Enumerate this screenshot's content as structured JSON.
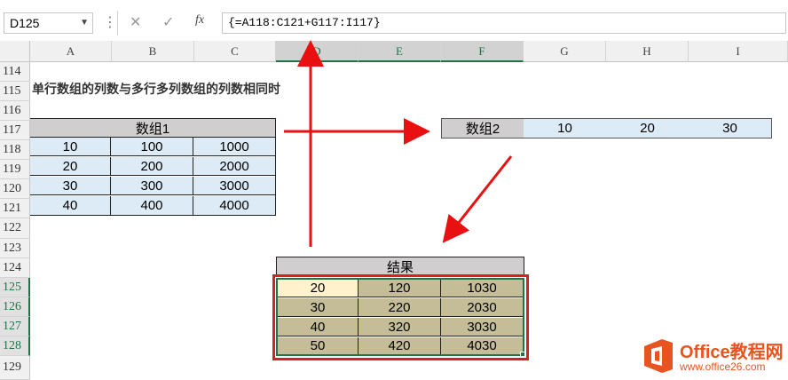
{
  "formula_bar": {
    "name_box": "D125",
    "cancel_icon": "✕",
    "enter_icon": "✓",
    "fx_label": "fx",
    "formula": "{=A118:C121+G117:I117}"
  },
  "columns": [
    "A",
    "B",
    "C",
    "D",
    "E",
    "F",
    "G",
    "H",
    "I"
  ],
  "rows": [
    "114",
    "115",
    "116",
    "117",
    "118",
    "119",
    "120",
    "121",
    "122",
    "123",
    "124",
    "125",
    "126",
    "127",
    "128",
    "129"
  ],
  "heading": "单行数组的列数与多行多列数组的列数相同时",
  "array1": {
    "label": "数组1",
    "rows": [
      [
        "10",
        "100",
        "1000"
      ],
      [
        "20",
        "200",
        "2000"
      ],
      [
        "30",
        "300",
        "3000"
      ],
      [
        "40",
        "400",
        "4000"
      ]
    ]
  },
  "array2": {
    "label": "数组2",
    "values": [
      "10",
      "20",
      "30"
    ]
  },
  "result": {
    "label": "结果",
    "rows": [
      [
        "20",
        "120",
        "1030"
      ],
      [
        "30",
        "220",
        "2030"
      ],
      [
        "40",
        "320",
        "3030"
      ],
      [
        "50",
        "420",
        "4030"
      ]
    ]
  },
  "watermark": {
    "brand": "Office教程网",
    "url": "www.office26.com"
  },
  "colors": {
    "excel_green": "#217346",
    "arrow_red": "#e81010",
    "highlight_red": "#d32222"
  }
}
